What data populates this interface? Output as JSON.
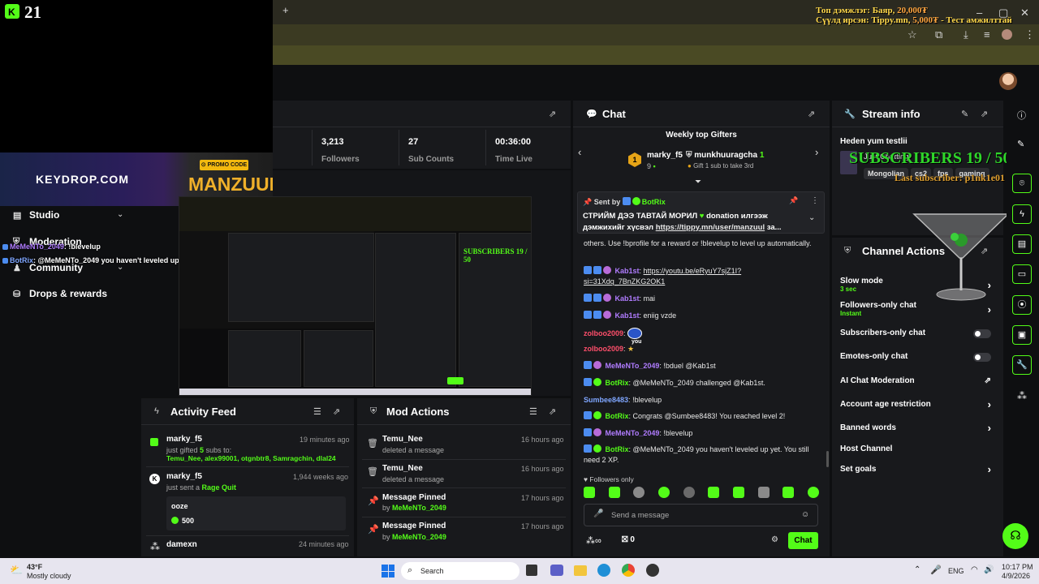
{
  "overlay": {
    "logo_number": "21",
    "top_donor_label": "Топ дэмжлэг:",
    "top_donor_name": "Баяр,",
    "top_donor_amount": "20,000₮",
    "last_tip_label": "Сүүлд ирсэн:",
    "last_tip_name": "Tippy.mn,",
    "last_tip_amount": "5,000₮",
    "last_tip_suffix": "- Тест амжилттай",
    "subscribers_text": "SUBSCRIBERS 19 / 50",
    "last_subscriber_text": "Last subscriber: p1nk1e01",
    "ad_site": "KEYDROP.COM",
    "ad_promo_label": "PROMO CODE",
    "ad_code": "MANZUUL",
    "chat_lines": [
      {
        "user": "MeMeNTo_2049",
        "text": ": !blevelup"
      },
      {
        "user": "BotRix",
        "text": ": @MeMeNTo_2049 you haven't leveled up yet. You still need 2 XP."
      }
    ]
  },
  "nav": {
    "studio": "Studio",
    "moderation": "Moderation",
    "community": "Community",
    "drops": "Drops & rewards"
  },
  "stats": {
    "followers_value": "3,213",
    "followers_label": "Followers",
    "subs_value": "27",
    "subs_label": "Sub Counts",
    "time_value": "00:36:00",
    "time_label": "Time Live"
  },
  "activity": {
    "title": "Activity Feed",
    "items": [
      {
        "name": "marky_f5",
        "time": "19 minutes ago",
        "line1_pre": "just gifted",
        "count": "5",
        "line1_post": "subs to:",
        "recipients": "Temu_Nee, alex99001, otgnbtr8, Samragchin, dlal24"
      },
      {
        "name": "marky_f5",
        "time": "1,944 weeks ago",
        "line1": "just sent a",
        "item": "Rage Quit",
        "box_title": "ooze",
        "box_value": "500"
      },
      {
        "name": "damexn",
        "time": "24 minutes ago"
      }
    ]
  },
  "mod_actions": {
    "title": "Mod Actions",
    "items": [
      {
        "name": "Temu_Nee",
        "sub": "deleted a message",
        "time": "16 hours ago"
      },
      {
        "name": "Temu_Nee",
        "sub": "deleted a message",
        "time": "16 hours ago"
      },
      {
        "name": "Message Pinned",
        "by": "by",
        "user": "MeMeNTo_2049",
        "time": "17 hours ago"
      },
      {
        "name": "Message Pinned",
        "by": "by",
        "user": "MeMeNTo_2049",
        "time": "17 hours ago"
      }
    ]
  },
  "chat": {
    "title": "Chat",
    "gifters_title": "Weekly top Gifters",
    "gifter1_name": "marky_f5",
    "gifter1_count": "9",
    "gifter2_name": "munkhuuragcha",
    "gifter2_count": "1",
    "gifter2_hint": "Gift 1 sub to take 3rd",
    "pinned_sent_by": "Sent by",
    "pinned_user": "BotRix",
    "pinned_text_1": "СТРИЙМ ДЭЭ ТАВТАЙ МОРИЛ",
    "pinned_text_2": "donation илгээж",
    "pinned_text_3": "дэмжихийг хүсвэл",
    "pinned_link": "https://tippy.mn/user/manzuul",
    "pinned_more": "за...",
    "messages": [
      {
        "user": "",
        "text": "others. Use !bprofile for a reward or !blevelup to level up automatically."
      },
      {
        "user": "Kab1st",
        "text": "https://youtu.be/eRyuY7sjZ1I?si=31Xdq_7BnZKG2OK1"
      },
      {
        "user": "Kab1st",
        "text": "mai"
      },
      {
        "user": "Kab1st",
        "text": "eniig vzde"
      },
      {
        "user": "zolboo2009",
        "text": ""
      },
      {
        "user": "zolboo2009",
        "text": ""
      },
      {
        "user": "MeMeNTo_2049",
        "text": "!bduel @Kab1st"
      },
      {
        "user": "BotRix",
        "text": "@MeMeNTo_2049 challenged @Kab1st."
      },
      {
        "user": "Sumbee8483",
        "text": "!blevelup"
      },
      {
        "user": "BotRix",
        "text": "Congrats @Sumbee8483! You reached level 2!"
      },
      {
        "user": "MeMeNTo_2049",
        "text": "!blevelup"
      },
      {
        "user": "BotRix",
        "text": "@MeMeNTo_2049 you haven't leveled up yet. You still need 2 XP."
      }
    ],
    "emote_you": "you",
    "followers_only": "Followers only",
    "input_placeholder": "Send a message",
    "points": "0",
    "send_label": "Chat"
  },
  "stream_info": {
    "title": "Stream info",
    "stream_title": "Heden yum testlii",
    "category": "Just Chatting",
    "tags": [
      "Mongolian",
      "cs2",
      "fps",
      "gaming"
    ]
  },
  "channel_actions": {
    "title": "Channel Actions",
    "slow_mode": "Slow mode",
    "slow_mode_value": "3 sec",
    "followers_only": "Followers-only chat",
    "followers_only_value": "Instant",
    "subs_only": "Subscribers-only chat",
    "emotes_only": "Emotes-only chat",
    "ai_mod": "AI Chat Moderation",
    "account_age": "Account age restriction",
    "banned_words": "Banned words",
    "host": "Host Channel",
    "goals": "Set goals"
  },
  "taskbar": {
    "temp": "43°F",
    "weather": "Mostly cloudy",
    "search": "Search",
    "lang": "ENG",
    "time": "10:17 PM",
    "date": "4/9/2026"
  },
  "colors": {
    "accent": "#53fc18",
    "panel": "#18191c",
    "bg": "#0e0f11"
  }
}
